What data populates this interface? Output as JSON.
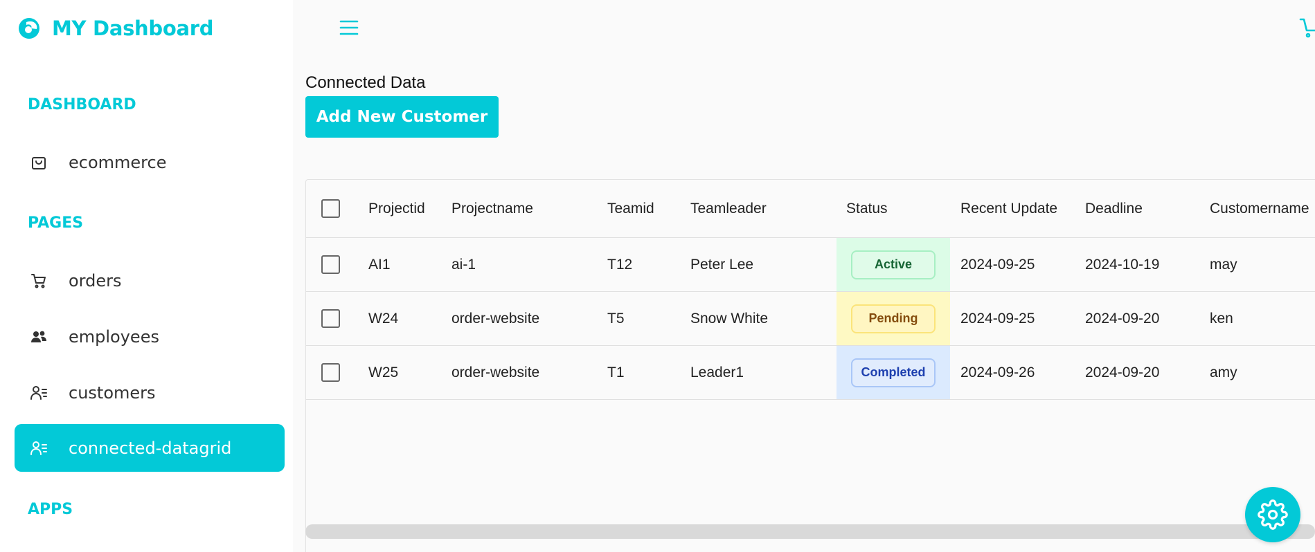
{
  "app": {
    "title": "MY Dashboard",
    "accent_color": "#03c9d7"
  },
  "sidebar": {
    "sections": [
      {
        "title": "DASHBOARD"
      },
      {
        "title": "PAGES"
      },
      {
        "title": "APPS"
      }
    ],
    "items": [
      {
        "label": "ecommerce",
        "icon": "shopping-bag-icon",
        "active": false
      },
      {
        "label": "orders",
        "icon": "cart-icon",
        "active": false
      },
      {
        "label": "employees",
        "icon": "people-icon",
        "active": false
      },
      {
        "label": "customers",
        "icon": "contact-list-icon",
        "active": false
      },
      {
        "label": "connected-datagrid",
        "icon": "contact-list-icon",
        "active": true
      }
    ]
  },
  "header": {
    "menu_icon": "hamburger-menu-icon",
    "cart_icon": "cart-icon"
  },
  "main": {
    "title": "Connected Data",
    "add_button_label": "Add New Customer"
  },
  "grid": {
    "columns": [
      "Projectid",
      "Projectname",
      "Teamid",
      "Teamleader",
      "Status",
      "Recent Update",
      "Deadline",
      "Customername"
    ],
    "rows": [
      {
        "projectid": "AI1",
        "projectname": "ai-1",
        "teamid": "T12",
        "teamleader": "Peter Lee",
        "status": "Active",
        "recent_update": "2024-09-25",
        "deadline": "2024-10-19",
        "customername": "may"
      },
      {
        "projectid": "W24",
        "projectname": "order-website",
        "teamid": "T5",
        "teamleader": "Snow White",
        "status": "Pending",
        "recent_update": "2024-09-25",
        "deadline": "2024-09-20",
        "customername": "ken"
      },
      {
        "projectid": "W25",
        "projectname": "order-website",
        "teamid": "T1",
        "teamleader": "Leader1",
        "status": "Completed",
        "recent_update": "2024-09-26",
        "deadline": "2024-09-20",
        "customername": "amy"
      }
    ],
    "status_colors": {
      "Active": "#dcfce7",
      "Pending": "#fef9c3",
      "Completed": "#dbeafe"
    }
  },
  "settings": {
    "icon": "gear-icon"
  }
}
